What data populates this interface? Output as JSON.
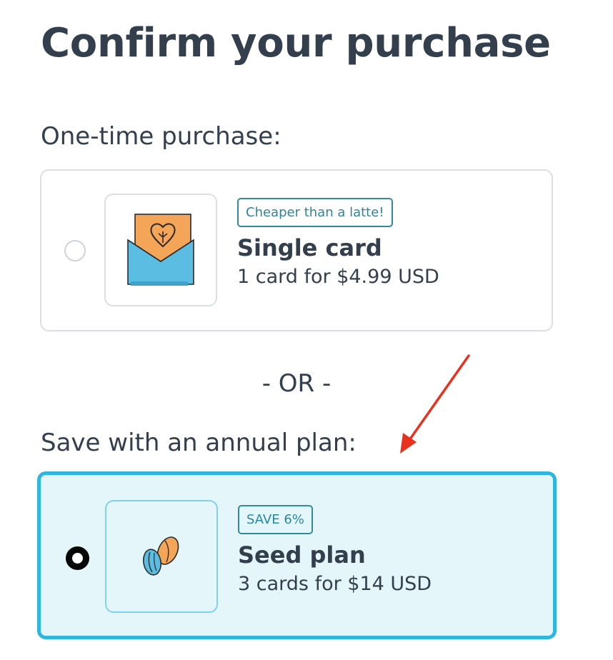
{
  "page": {
    "title": "Confirm your purchase"
  },
  "one_time": {
    "heading": "One-time purchase:",
    "option": {
      "selected": false,
      "icon": "card-envelope-icon",
      "badge": "Cheaper than a latte!",
      "name": "Single card",
      "price": "1 card for $4.99 USD"
    }
  },
  "divider": {
    "label": "- OR -"
  },
  "annual": {
    "heading": "Save with an annual plan:",
    "option": {
      "selected": true,
      "icon": "seeds-icon",
      "badge": "SAVE 6%",
      "name": "Seed plan",
      "price": "3 cards for $14 USD"
    }
  },
  "annotation": {
    "icon": "red-arrow-icon",
    "color": "#e8321e"
  },
  "colors": {
    "text": "#333f4d",
    "accent": "#2db6de",
    "selected_bg": "#e5f6fb",
    "badge": "#2a86a0",
    "envelope_blue": "#5bbde2",
    "card_orange": "#f4a558"
  }
}
